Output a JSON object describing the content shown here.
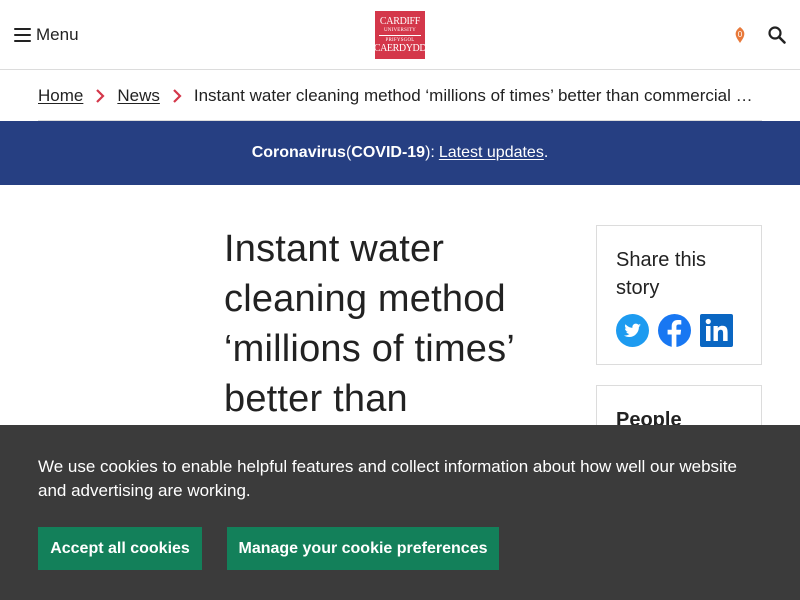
{
  "header": {
    "menu_label": "Menu",
    "logo": {
      "line1": "CARDIFF",
      "line2": "UNIVERSITY",
      "line3": "PRIFYSGOL",
      "line4": "CAERDYDD"
    },
    "notification_badge": "0"
  },
  "breadcrumb": {
    "items": [
      "Home",
      "News"
    ],
    "current": "Instant water cleaning method ‘millions of times’ better than commercial a…"
  },
  "banner": {
    "bold": "Coronavirus",
    "paren_open": " (",
    "bold2": "COVID-19",
    "after": "):",
    "link": "Latest updates",
    "end": ".",
    "background": "#263f82"
  },
  "article": {
    "title": "Instant water cleaning method ‘millions of times’ better than"
  },
  "sidebar": {
    "share_title": "Share this story",
    "share_icons": [
      "twitter-icon",
      "facebook-icon",
      "linkedin-icon"
    ],
    "people_title": "People"
  },
  "cookie": {
    "text": "We use cookies to enable helpful features and collect information about how well our website and advertising are working.",
    "accept_label": "Accept all cookies",
    "manage_label": "Manage your cookie preferences",
    "button_color": "#13805a",
    "background": "#3b3b3b"
  },
  "colors": {
    "brand_red": "#d4374a",
    "twitter": "#1d9bf0",
    "facebook": "#1877f2",
    "linkedin": "#0a66c2",
    "breadcrumb_chevron": "#d4374a",
    "notification": "#e8793a"
  }
}
